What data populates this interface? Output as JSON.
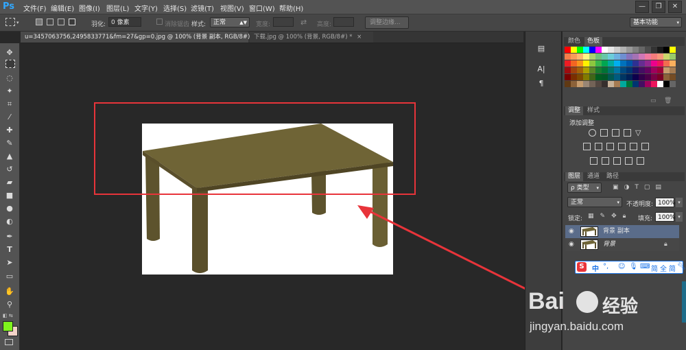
{
  "app": {
    "logo": "Ps"
  },
  "menu": [
    "文件(F)",
    "编辑(E)",
    "图像(I)",
    "图层(L)",
    "文字(Y)",
    "选择(S)",
    "滤镜(T)",
    "视图(V)",
    "窗口(W)",
    "帮助(H)"
  ],
  "window_controls": [
    "—",
    "❐",
    "✕"
  ],
  "options": {
    "feather_label": "羽化:",
    "feather_value": "0 像素",
    "antialias_label": "消除锯齿",
    "style_label": "样式:",
    "style_value": "正常",
    "width_label": "宽度:",
    "height_label": "高度:",
    "refine_edge": "调整边缘...",
    "workspace": "基本功能"
  },
  "tabs": [
    {
      "label": "u=3457063756,2495833771&fm=27&gp=0.jpg @ 100% (背景 副本, RGB/8#) *",
      "close": "×"
    },
    {
      "label": "下载.jpg @ 100% (背景, RGB/8#) *",
      "close": "×"
    }
  ],
  "panels": {
    "color_tabs": [
      "颜色",
      "色板"
    ],
    "adjust_tabs": [
      "调整",
      "样式"
    ],
    "adjust_title": "添加调整",
    "layer_tabs": [
      "图层",
      "通道",
      "路径"
    ],
    "kind_label": "ρ 类型",
    "blend_mode": "正常",
    "opacity_label": "不透明度:",
    "opacity_value": "100%",
    "lock_label": "锁定:",
    "fill_label": "填充:",
    "fill_value": "100%",
    "layers": [
      {
        "name": "背景 副本",
        "selected": true
      },
      {
        "name": "背景",
        "selected": false,
        "locked": true
      }
    ]
  },
  "ime_bar": {
    "chars": [
      "中",
      "简",
      "全",
      "简"
    ],
    "mark": "°,"
  },
  "watermark": {
    "brand": "Bai",
    "brand_cn": "经验",
    "url": "jingyan.baidu.com"
  },
  "colors": {
    "table_top": "#6f6436",
    "table_dark": "#5a4f2b",
    "annotation_red": "#e8343a",
    "fg_color": "#7ff41d",
    "bg_color": "#f3d3c8"
  },
  "swatches": [
    "#ff0000",
    "#ffff00",
    "#00ff00",
    "#00ffff",
    "#0000ff",
    "#ff00ff",
    "#ffffff",
    "#e6e6e6",
    "#cccccc",
    "#b3b3b3",
    "#999999",
    "#808080",
    "#666666",
    "#4d4d4d",
    "#333333",
    "#1a1a1a",
    "#000000",
    "#ffff00",
    "#f47d4a",
    "#f79b5b",
    "#fbb96e",
    "#fff684",
    "#a9d46f",
    "#6fc17d",
    "#67c7a8",
    "#6ccdd9",
    "#6cb0e0",
    "#6e8fd1",
    "#8772bc",
    "#a472b4",
    "#cf77b7",
    "#f07aa0",
    "#f57c7c",
    "#f7977a",
    "#cbd76a",
    "#9acb6a",
    "#ed1c24",
    "#f26522",
    "#f7941d",
    "#fff200",
    "#8dc63f",
    "#39b54a",
    "#00a651",
    "#00a99d",
    "#00aeef",
    "#0072bc",
    "#0054a6",
    "#2e3192",
    "#662d91",
    "#92278f",
    "#ec008c",
    "#ed145b",
    "#f26c4f",
    "#fbaf5d",
    "#9e0b0f",
    "#a0410d",
    "#a3620a",
    "#aba000",
    "#598527",
    "#197b30",
    "#007236",
    "#00746b",
    "#0076a3",
    "#004a80",
    "#003471",
    "#1b1464",
    "#440e62",
    "#630460",
    "#9e005d",
    "#9e0039",
    "#c69c6d",
    "#a67c52",
    "#790000",
    "#7b2e00",
    "#7d4900",
    "#827b00",
    "#406618",
    "#005e20",
    "#005826",
    "#005952",
    "#005b7f",
    "#003663",
    "#002157",
    "#0d004c",
    "#32004b",
    "#4b0049",
    "#7b0046",
    "#7a0026",
    "#8c6239",
    "#754c24",
    "#603913",
    "#8c6239",
    "#c69c6d",
    "#998675",
    "#736357",
    "#534741",
    "#362f2d",
    "#c7b299",
    "#a67c52",
    "#00a99d",
    "#007236",
    "#003471",
    "#440e62",
    "#9e005d",
    "#ed145b",
    "#ffffff",
    "#000000",
    "#666666"
  ]
}
